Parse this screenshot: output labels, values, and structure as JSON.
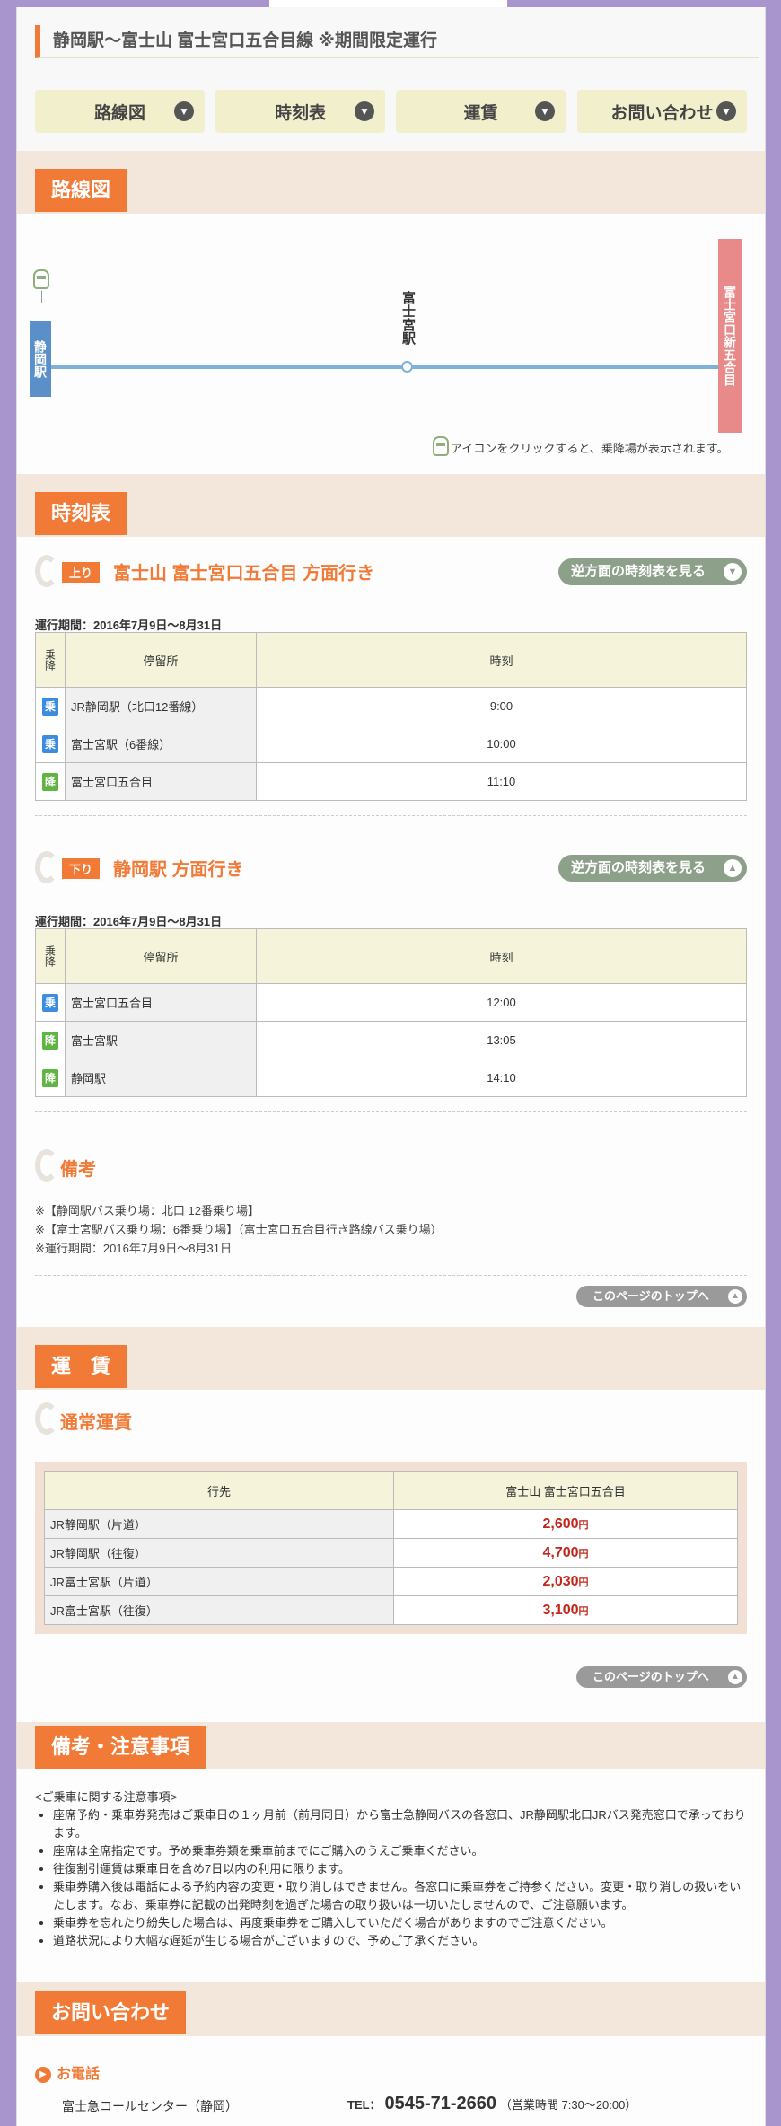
{
  "header": {
    "title": "静岡駅～富士山 富士宮口五合目線 ※期間限定運行"
  },
  "tabs": [
    {
      "label": "路線図"
    },
    {
      "label": "時刻表"
    },
    {
      "label": "運賃"
    },
    {
      "label": "お問い合わせ"
    }
  ],
  "route": {
    "heading": "路線図",
    "start_stop": "静岡駅",
    "mid_stop": "富士宮駅",
    "end_stop": "富士宮口新五合目",
    "note": "アイコンをクリックすると、乗降場が表示されます。"
  },
  "timetable": {
    "heading": "時刻表",
    "col_ride": "乗降",
    "col_stop": "停留所",
    "col_time": "時刻",
    "up": {
      "badge": "上り",
      "title": "富士山 富士宮口五合目 方面行き",
      "reverse_label": "逆方面の時刻表を見る",
      "period": "運行期間：2016年7月9日～8月31日",
      "rows": [
        {
          "tag": "乗",
          "stop": "JR静岡駅（北口12番線）",
          "time": "9:00"
        },
        {
          "tag": "乗",
          "stop": "富士宮駅（6番線）",
          "time": "10:00"
        },
        {
          "tag": "降",
          "stop": "富士宮口五合目",
          "time": "11:10"
        }
      ]
    },
    "down": {
      "badge": "下り",
      "title": "静岡駅 方面行き",
      "reverse_label": "逆方面の時刻表を見る",
      "period": "運行期間：2016年7月9日～8月31日",
      "rows": [
        {
          "tag": "乗",
          "stop": "富士宮口五合目",
          "time": "12:00"
        },
        {
          "tag": "降",
          "stop": "富士宮駅",
          "time": "13:05"
        },
        {
          "tag": "降",
          "stop": "静岡駅",
          "time": "14:10"
        }
      ]
    },
    "remarks_title": "備考",
    "remarks": [
      "※【静岡駅バス乗り場：北口 12番乗り場】",
      "※【富士宮駅バス乗り場：6番乗り場】（富士宮口五合目行き路線バス乗り場）",
      "※運行期間：2016年7月9日～8月31日"
    ],
    "top_label": "このページのトップへ"
  },
  "fare": {
    "heading": "運　賃",
    "sub": "通常運賃",
    "col_dest": "行先",
    "col_target": "富士山 富士宮口五合目",
    "yen": "円",
    "rows": [
      {
        "dest": "JR静岡駅（片道）",
        "price": "2,600"
      },
      {
        "dest": "JR静岡駅（往復）",
        "price": "4,700"
      },
      {
        "dest": "JR富士宮駅（片道）",
        "price": "2,030"
      },
      {
        "dest": "JR富士宮駅（往復）",
        "price": "3,100"
      }
    ],
    "top_label": "このページのトップへ"
  },
  "notes": {
    "heading": "備考・注意事項",
    "intro": "<ご乗車に関する注意事項>",
    "items": [
      "座席予約・乗車券発売はご乗車日の１ヶ月前（前月同日）から富士急静岡バスの各窓口、JR静岡駅北口JRバス発売窓口で承っております。",
      "座席は全席指定です。予め乗車券類を乗車前までにご購入のうえご乗車ください。",
      "往復割引運賃は乗車日を含め7日以内の利用に限ります。",
      "乗車券購入後は電話による予約内容の変更・取り消しはできません。各窓口に乗車券をご持参ください。変更・取り消しの扱いをいたします。なお、乗車券に記載の出発時刻を過ぎた場合の取り扱いは一切いたしませんので、ご注意願います。",
      "乗車券を忘れたり紛失した場合は、再度乗車券をご購入していただく場合がありますのでご注意ください。",
      "道路状況により大幅な遅延が生じる場合がございますので、予めご了承ください。"
    ]
  },
  "contact": {
    "heading": "お問い合わせ",
    "phone_heading": "お電話",
    "center": "富士急コールセンター（静岡）",
    "tel_label": "TEL：",
    "tel": "0545-71-2660",
    "hours": "（営業時間 7:30～20:00）"
  },
  "colors": {
    "accent": "#f07a36",
    "board": "#3b8de0",
    "alight": "#5fb442",
    "price": "#c0261b"
  }
}
